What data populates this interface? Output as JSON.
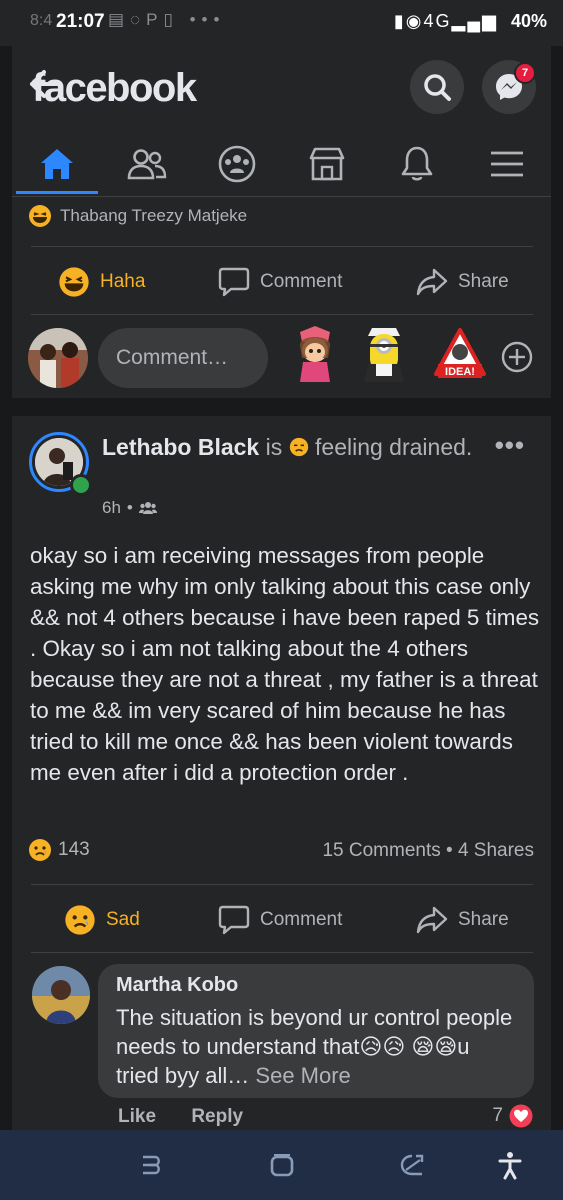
{
  "status_bar": {
    "time": "21:07",
    "ghost_time": "8:4",
    "signal": "4G",
    "battery": "40%"
  },
  "header": {
    "logo": "facebook",
    "back_icon": "back-arrow-icon",
    "badge_count": "7"
  },
  "tabs": [
    {
      "name": "home-icon",
      "active": true
    },
    {
      "name": "friends-icon",
      "active": false
    },
    {
      "name": "groups-icon",
      "active": false
    },
    {
      "name": "marketplace-icon",
      "active": false
    },
    {
      "name": "bell-icon",
      "active": false
    },
    {
      "name": "menu-icon",
      "active": false
    }
  ],
  "prev_post": {
    "reactor": "Thabang Treezy Matjeke",
    "actions": {
      "haha": "Haha",
      "comment": "Comment",
      "share": "Share"
    },
    "comment_placeholder": "Comment…"
  },
  "post": {
    "author": "Lethabo Black",
    "is_text": "is",
    "feeling": "feeling drained.",
    "time": "6h",
    "body": "okay so i am receiving messages from people asking me why im only talking about this case only && not 4 others because i have been raped 5 times . Okay so i am not talking about the 4 others because they are not a threat , my father is a threat to me && im very scared of him because he has tried to kill me once && has been violent towards me even after i did a protection order .",
    "reaction_count": "143",
    "comments_shares": "15 Comments • 4 Shares",
    "actions": {
      "sad": "Sad",
      "comment": "Comment",
      "share": "Share"
    }
  },
  "comment": {
    "name": "Martha Kobo",
    "text": "The situation is beyond ur control people needs to understand that😥😥 😪😪u tried byy all…",
    "see_more": "See More",
    "like": "Like",
    "reply": "Reply",
    "count": "7"
  },
  "colors": {
    "background": "#18191a",
    "card": "#242526",
    "accent": "#2d88ff",
    "haha": "#f7b125",
    "navbar": "#202d45"
  }
}
